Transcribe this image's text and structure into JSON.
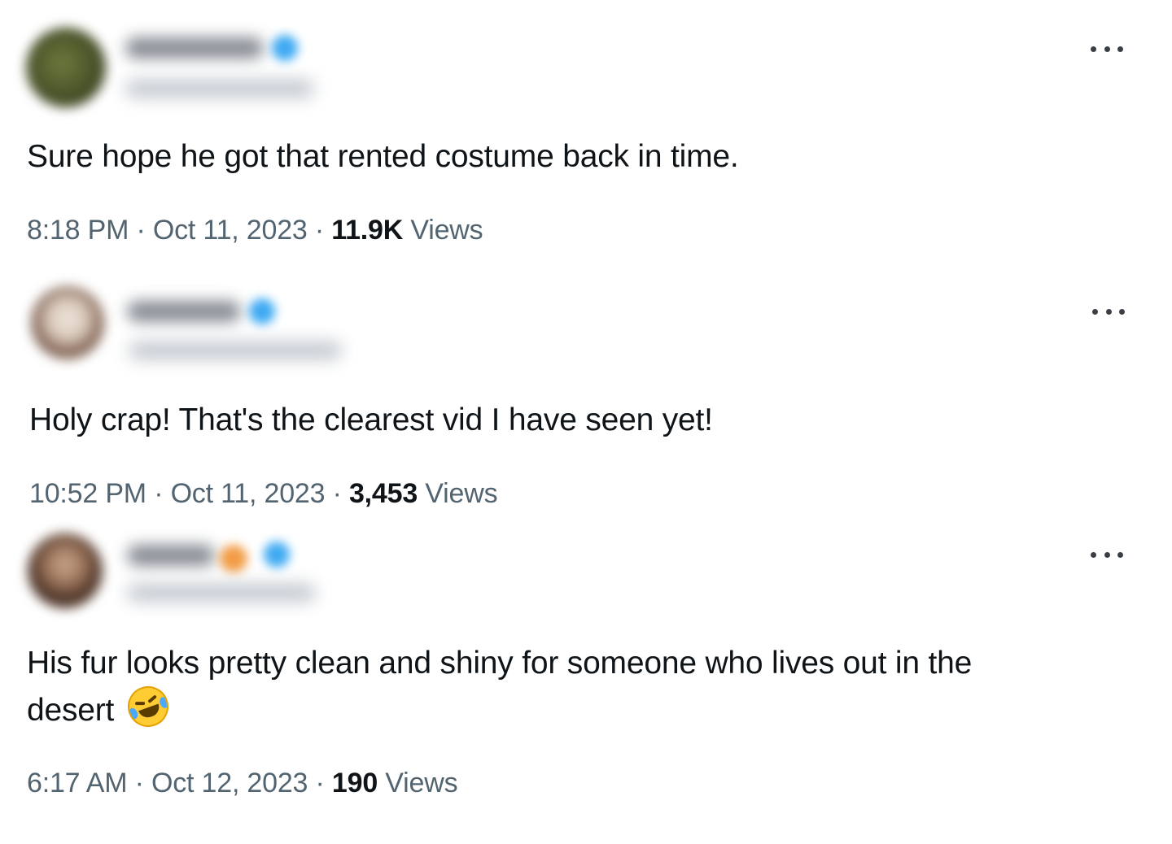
{
  "tweets": [
    {
      "text": "Sure hope he got that rented costume back in time.",
      "time": "8:18 PM",
      "date": "Oct 11, 2023",
      "views_count": "11.9K",
      "views_label": "Views",
      "separator": "·"
    },
    {
      "text": "Holy crap! That's the clearest vid I have seen yet!",
      "time": "10:52 PM",
      "date": "Oct 11, 2023",
      "views_count": "3,453",
      "views_label": "Views",
      "separator": "·"
    },
    {
      "text_line1": "His fur looks pretty clean and shiny for someone who lives out in the",
      "text_line2": "desert",
      "emoji_icon": "rolling-on-floor-laughing-emoji-icon",
      "time": "6:17 AM",
      "date": "Oct 12, 2023",
      "views_count": "190",
      "views_label": "Views",
      "separator": "·"
    }
  ],
  "icons": {
    "more": "more-options-icon",
    "verified": "verified-badge-icon"
  },
  "colors": {
    "text": "#0f1419",
    "secondary": "#536471",
    "verified": "#1d9bf0"
  }
}
